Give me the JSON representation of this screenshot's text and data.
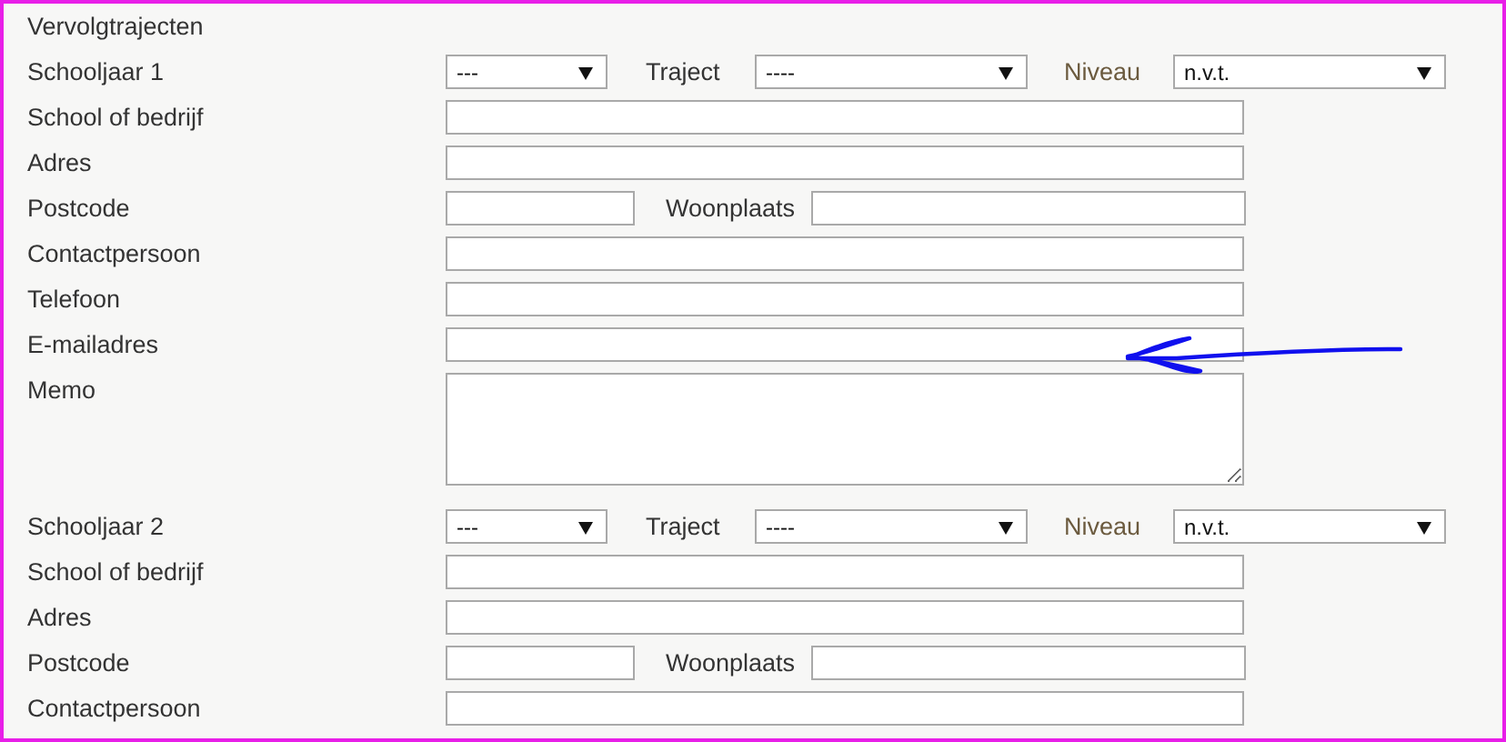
{
  "section_title": "Vervolgtrajecten",
  "years": [
    {
      "label": "Schooljaar 1",
      "year_select": "---",
      "traject_label": "Traject",
      "traject_select": "----",
      "niveau_label": "Niveau",
      "niveau_select": "n.v.t.",
      "fields": [
        {
          "kind": "text",
          "label": "School of bedrijf"
        },
        {
          "kind": "text",
          "label": "Adres"
        },
        {
          "kind": "split",
          "label": "Postcode",
          "second_label": "Woonplaats"
        },
        {
          "kind": "text",
          "label": "Contactpersoon"
        },
        {
          "kind": "text",
          "label": "Telefoon"
        },
        {
          "kind": "text",
          "label": "E-mailadres"
        },
        {
          "kind": "memo",
          "label": "Memo"
        }
      ]
    },
    {
      "label": "Schooljaar 2",
      "year_select": "---",
      "traject_label": "Traject",
      "traject_select": "----",
      "niveau_label": "Niveau",
      "niveau_select": "n.v.t.",
      "fields": [
        {
          "kind": "text",
          "label": "School of bedrijf"
        },
        {
          "kind": "text",
          "label": "Adres"
        },
        {
          "kind": "split",
          "label": "Postcode",
          "second_label": "Woonplaats"
        },
        {
          "kind": "text",
          "label": "Contactpersoon"
        }
      ]
    }
  ],
  "annotation": {
    "kind": "arrow"
  }
}
